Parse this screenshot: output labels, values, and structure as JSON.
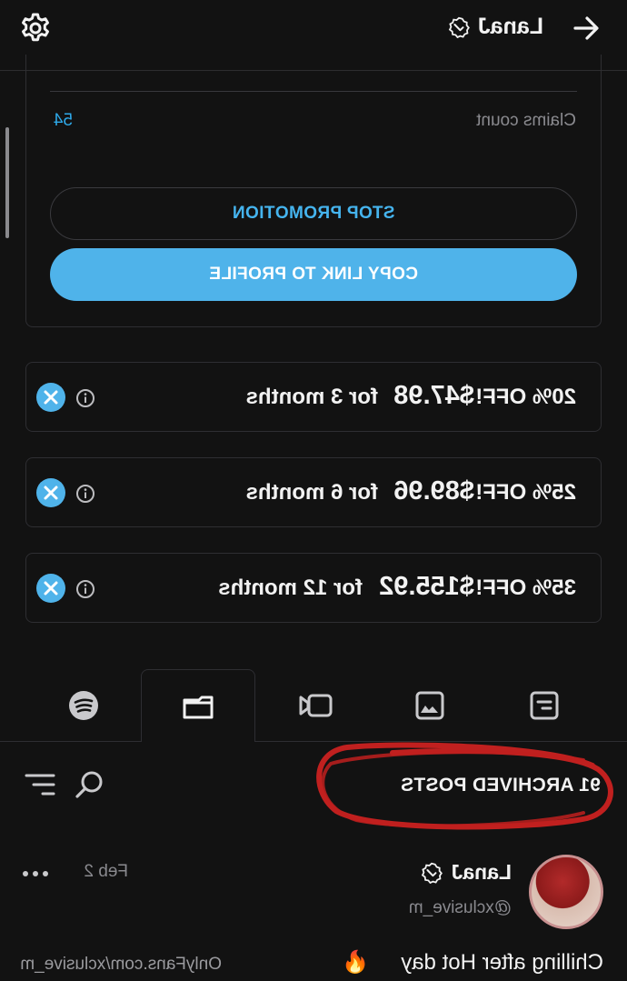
{
  "header": {
    "name": "LanaJ",
    "back_icon": "arrow-left-icon",
    "settings_icon": "gear-icon",
    "verified_icon": "verified-badge-icon"
  },
  "promotion": {
    "claims_label": "Claims count",
    "claims_value": "54",
    "stop_button": "STOP PROMOTION",
    "copy_button": "COPY LINK TO PROFILE"
  },
  "offers": [
    {
      "percent": "20% OFF!",
      "price": "$47.98",
      "period": "for 3 months"
    },
    {
      "percent": "25% OFF!",
      "price": "$89.96",
      "period": "for 6 months"
    },
    {
      "percent": "35% OFF!",
      "price": "$155.92",
      "period": "for 12 months"
    }
  ],
  "tabs": [
    {
      "icon": "post-icon",
      "active": false
    },
    {
      "icon": "image-icon",
      "active": false
    },
    {
      "icon": "video-icon",
      "active": false
    },
    {
      "icon": "folder-icon",
      "active": true
    },
    {
      "icon": "spotify-icon",
      "active": false
    }
  ],
  "archive": {
    "label": "91 ARCHIVED POSTS",
    "search_icon": "search-icon",
    "filter_icon": "filter-icon"
  },
  "post": {
    "name": "LanaJ",
    "handle": "@xclusive_m",
    "date": "Feb 2",
    "text": "Chilling after Hot day",
    "emoji": "🔥",
    "watermark": "OnlyFans.com/xclusive_m"
  },
  "colors": {
    "accent": "#4fb3ea",
    "background": "#121212",
    "border": "#2e2e32",
    "annotation": "#c0201f"
  }
}
